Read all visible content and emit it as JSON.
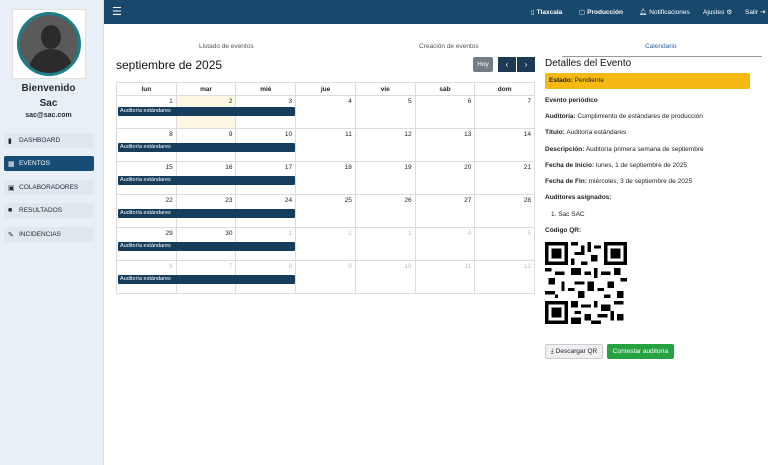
{
  "sidebar": {
    "welcome": "Bienvenido",
    "username": "Sac",
    "email": "sac@sac.com",
    "items": [
      {
        "label": "DASHBOARD",
        "icon": "bar-chart-icon"
      },
      {
        "label": "EVENTOS",
        "icon": "calendar-icon",
        "active": true
      },
      {
        "label": "COLABORADORES",
        "icon": "id-card-icon"
      },
      {
        "label": "RESULTADOS",
        "icon": "clipboard-icon"
      },
      {
        "label": "INCIDENCIAS",
        "icon": "wrench-icon"
      }
    ]
  },
  "topbar": {
    "tlaxcala": "Tlaxcala",
    "produccion": "Producción",
    "notificaciones": "Notificaciones",
    "ajustes": "Ajustes",
    "salir": "Salir"
  },
  "tabs": [
    "Listado de eventos",
    "Creación de eventos",
    "Calendario"
  ],
  "calendar": {
    "title": "septiembre de 2025",
    "today_label": "Hoy",
    "weekdays": [
      "lun",
      "mar",
      "mié",
      "jue",
      "vie",
      "sáb",
      "dom"
    ],
    "weeks": [
      [
        "1",
        "2",
        "3",
        "4",
        "5",
        "6",
        "7"
      ],
      [
        "8",
        "9",
        "10",
        "11",
        "12",
        "13",
        "14"
      ],
      [
        "15",
        "16",
        "17",
        "18",
        "19",
        "20",
        "21"
      ],
      [
        "22",
        "23",
        "24",
        "25",
        "26",
        "27",
        "28"
      ],
      [
        "29",
        "30",
        "1",
        "2",
        "3",
        "4",
        "5"
      ],
      [
        "6",
        "7",
        "8",
        "9",
        "10",
        "11",
        "12"
      ]
    ],
    "event_label": "Auditoría estándares"
  },
  "details": {
    "title": "Detalles del Evento",
    "estado_label": "Estado:",
    "estado_value": "Pendiente",
    "periodic": "Evento periódico",
    "auditoria_label": "Auditoría:",
    "auditoria_value": "Cumplimiento de estándares de producción",
    "titulo_label": "Título:",
    "titulo_value": "Auditoría estándares",
    "descripcion_label": "Descripción:",
    "descripcion_value": "Auditoría primera semana de septiembre",
    "inicio_label": "Fecha de Inicio:",
    "inicio_value": "lunes, 1 de septiembre de 2025",
    "fin_label": "Fecha de Fin:",
    "fin_value": "miércoles, 3 de septiembre de 2025",
    "auditores_label": "Auditores asignados:",
    "auditor_1": "1. Sac SAC",
    "qr_label": "Código QR:",
    "download_qr": "Descargar QR",
    "answer": "Contestar auditoría"
  }
}
